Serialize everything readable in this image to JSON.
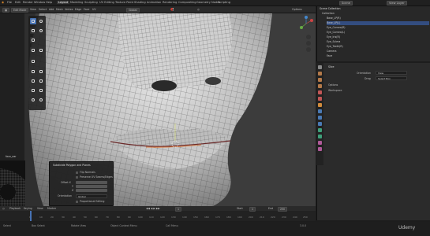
{
  "topbar": {
    "menus": [
      "File",
      "Edit",
      "Render",
      "Window",
      "Help"
    ],
    "workspaces": [
      "Layout",
      "Modeling",
      "Sculpting",
      "UV Editing",
      "Texture Paint",
      "Shading",
      "Animation",
      "Rendering",
      "Compositing",
      "Geometry Nodes",
      "Scripting"
    ],
    "active_workspace": "Layout",
    "scene_label": "Scene",
    "view_layer_label": "View Layer"
  },
  "header": {
    "mode": "Edit Mode",
    "orientation_label": "Orientation:",
    "orientation_value": "Default",
    "drag_label": "Drag:",
    "drag_value": "Select Box",
    "view": "View",
    "select": "Select",
    "add": "Add",
    "mesh": "Mesh",
    "vertex": "Vertex",
    "edge": "Edge",
    "face": "Face",
    "uv": "UV",
    "transform": "Global",
    "options": "Options"
  },
  "thumbnail_label": "face_ear",
  "operator_panel": {
    "title": "Subdivide Polygon and Planes",
    "rows": [
      {
        "label": "Flip Normals"
      },
      {
        "label": "Preserve UV Seams/Edges"
      }
    ],
    "offset_label": "Offset X",
    "fields": [
      "Y",
      "Z"
    ],
    "orientation_label": "Orientation",
    "orientation_value": "Global",
    "proportional_label": "Proportional Editing"
  },
  "timeline": {
    "menus": [
      "Playback",
      "Keying",
      "View",
      "Marker"
    ],
    "current_frame": "1",
    "start_label": "Start",
    "start": "1",
    "end_label": "End",
    "end": "250",
    "ticks": [
      "0",
      "10",
      "20",
      "30",
      "40",
      "50",
      "60",
      "70",
      "80",
      "90",
      "100",
      "110",
      "120",
      "130",
      "140",
      "150",
      "160",
      "170",
      "180",
      "190",
      "200",
      "210",
      "220",
      "230",
      "240",
      "250"
    ]
  },
  "status": {
    "items": [
      "Select",
      "Box Select",
      "Rotate View",
      "Object Context Menu",
      "Call Menu"
    ],
    "version": "3.0.0"
  },
  "outliner": {
    "title": "Scene Collection",
    "items": [
      {
        "label": "Collection",
        "selected": false
      },
      {
        "label": "Base_LP(R)",
        "selected": false
      },
      {
        "label": "Base_LP(L)",
        "selected": true
      },
      {
        "label": "Eye_Cornea(R)",
        "selected": false
      },
      {
        "label": "Eye_Cornea(L)",
        "selected": false
      },
      {
        "label": "Eye_Iris(R)",
        "selected": false
      },
      {
        "label": "Eye_Sclera",
        "selected": false
      },
      {
        "label": "Eye_Teeth(R)",
        "selected": false
      },
      {
        "label": "Camera",
        "selected": false
      },
      {
        "label": "Face",
        "selected": false
      }
    ]
  },
  "properties": {
    "section": "Slice",
    "orientation_label": "Orientation",
    "orientation_value": "View",
    "snap_label": "Drag",
    "snap_value": "Select Box",
    "options_label": "Options",
    "workspace_label": "Workspace"
  },
  "watermark": "Udemy",
  "colors": {
    "accent": "#4772b3",
    "selected_row": "#334d80",
    "viewport_bg": "#3b3b3b"
  }
}
